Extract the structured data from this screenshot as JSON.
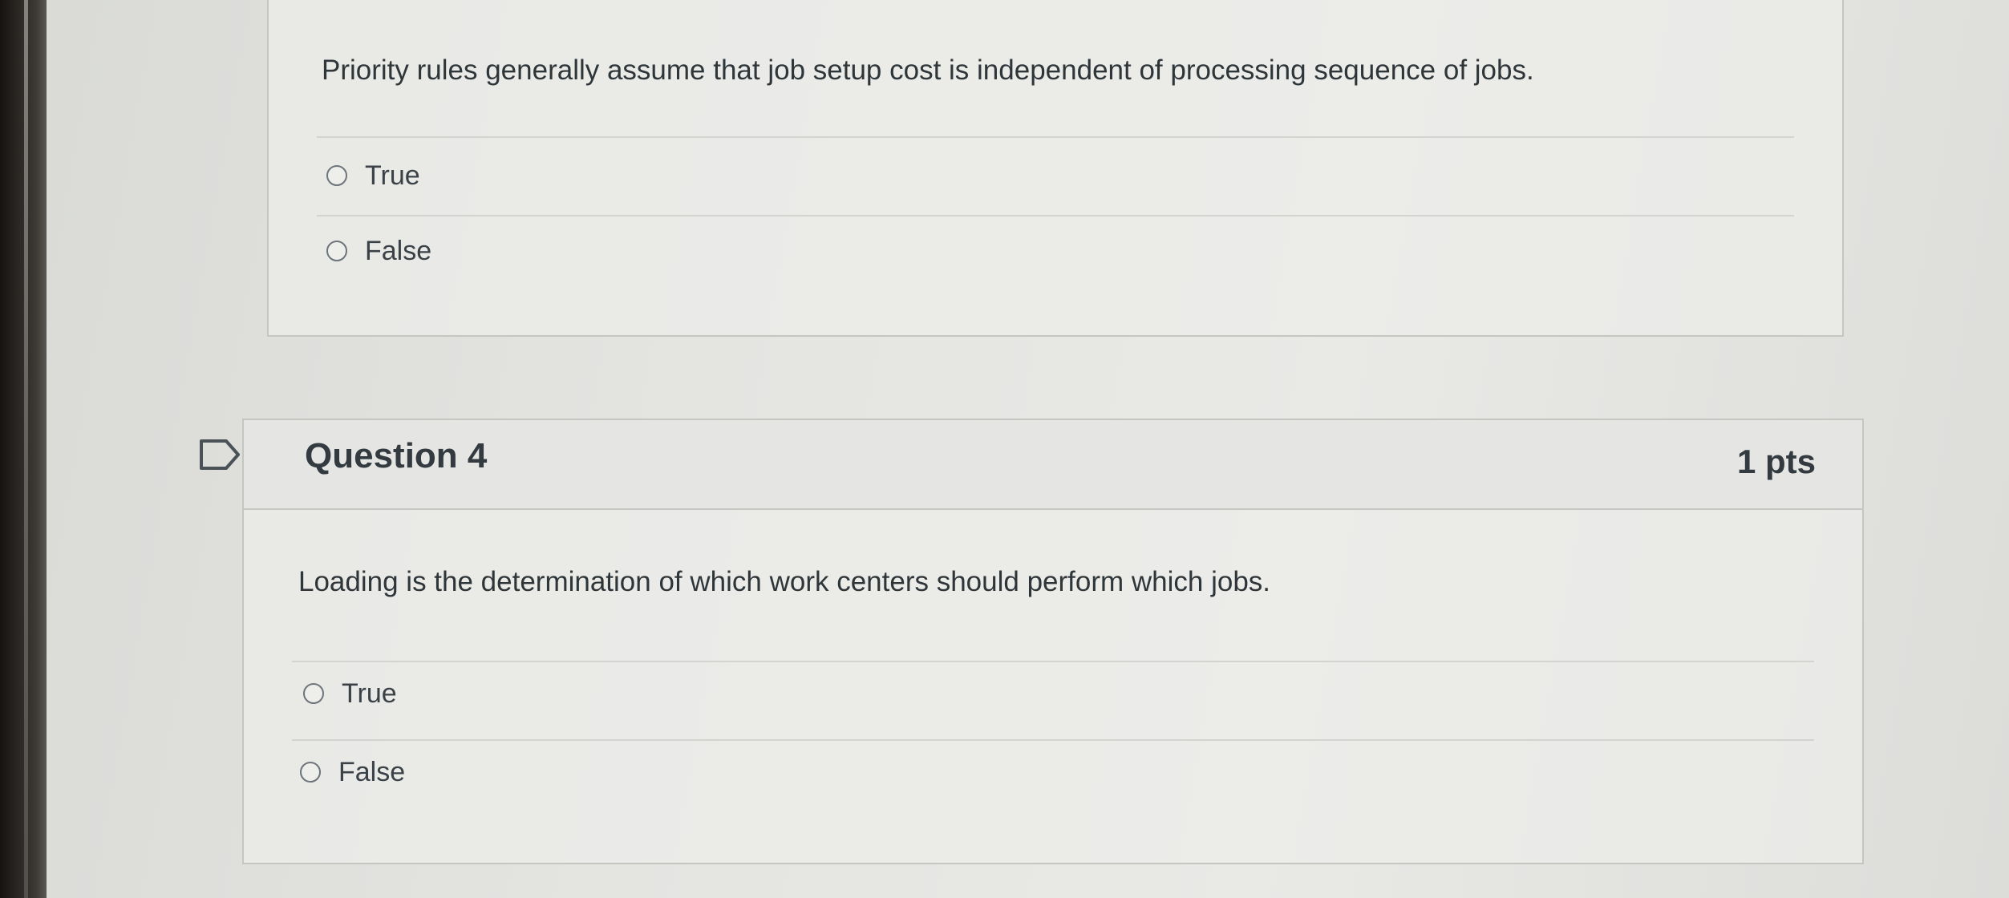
{
  "questions": [
    {
      "text": "Priority rules generally assume that job setup cost is independent of processing sequence of jobs.",
      "answers": [
        "True",
        "False"
      ]
    },
    {
      "title": "Question 4",
      "points": "1 pts",
      "text": "Loading is the determination of which work centers should perform which jobs.",
      "answers": [
        "True",
        "False"
      ]
    }
  ],
  "icons": {
    "flag": "flag-question-icon",
    "radio": "radio-unselected-icon"
  },
  "colors": {
    "text": "#2d3b45",
    "border": "#c4c6c2",
    "background": "#e4e4e1"
  }
}
